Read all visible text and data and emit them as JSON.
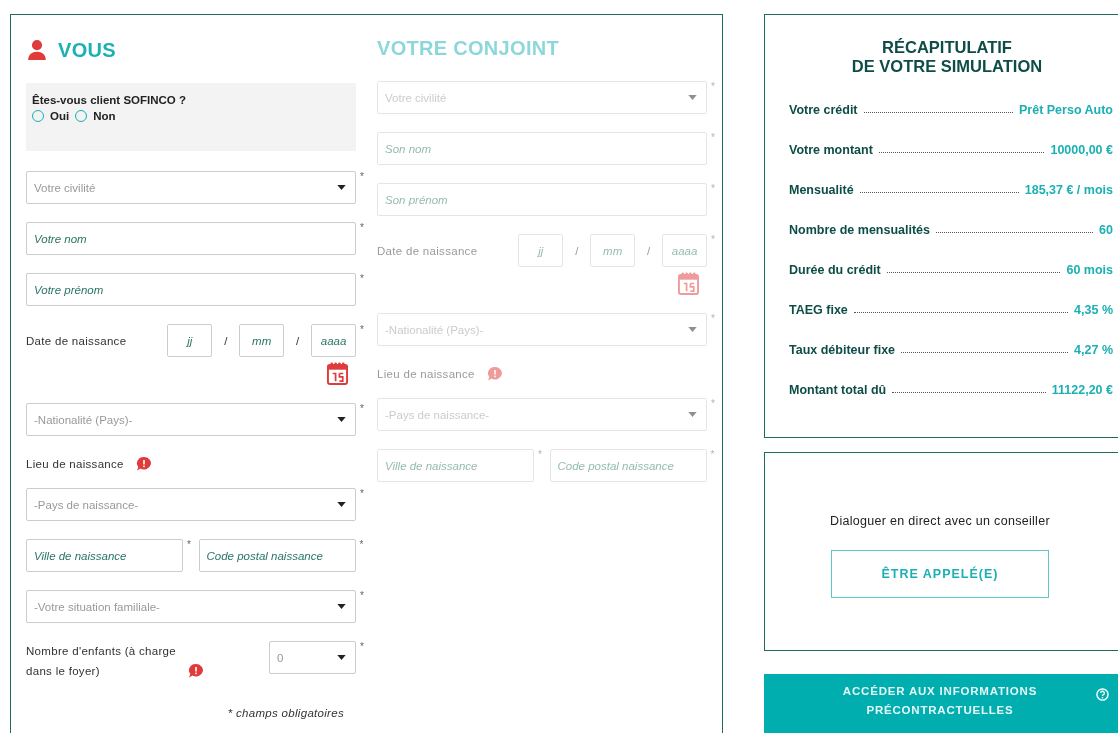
{
  "columns": [
    {
      "title": "VOUS",
      "person_icon": true,
      "disabled": false,
      "client_question": {
        "label": "Êtes-vous client SOFINCO ?",
        "options": [
          {
            "label": "Oui",
            "selected": false
          },
          {
            "label": "Non",
            "selected": false
          }
        ]
      },
      "fields": [
        {
          "kind": "select",
          "placeholder": "Votre civilité",
          "mark": "*"
        },
        {
          "kind": "text",
          "placeholder": "Votre nom",
          "mark": "*"
        },
        {
          "kind": "text",
          "placeholder": "Votre prénom",
          "mark": "*"
        },
        {
          "kind": "date",
          "label": "Date de naissance",
          "placeholders": [
            "jj",
            "mm",
            "aaaa"
          ],
          "separators": [
            "/",
            "/"
          ],
          "mark": "*"
        },
        {
          "kind": "select",
          "placeholder": "-Nationalité (Pays)-",
          "mark": "*"
        },
        {
          "kind": "label",
          "label": "Lieu de naissance",
          "help": true
        },
        {
          "kind": "select",
          "placeholder": "-Pays de naissance-",
          "mark": "*"
        },
        {
          "kind": "pair",
          "placeholders": [
            "Ville de naissance",
            "Code postal naissance"
          ],
          "marks": [
            "*",
            "*"
          ]
        },
        {
          "kind": "select",
          "placeholder": "-Votre situation familiale-",
          "mark": "*"
        },
        {
          "kind": "count",
          "label": "Nombre d'enfants (à charge dans le foyer)",
          "help": true,
          "placeholder": "0",
          "mark": "*"
        }
      ],
      "footnote": "* champs obligatoires"
    },
    {
      "title": "VOTRE CONJOINT",
      "person_icon": false,
      "disabled": true,
      "fields": [
        {
          "kind": "select",
          "placeholder": "Votre civilité",
          "mark": "*"
        },
        {
          "kind": "text",
          "placeholder": "Son nom",
          "mark": "*"
        },
        {
          "kind": "text",
          "placeholder": "Son prénom",
          "mark": "*"
        },
        {
          "kind": "date",
          "label": "Date de naissance",
          "placeholders": [
            "jj",
            "mm",
            "aaaa"
          ],
          "separators": [
            "/",
            "/"
          ],
          "mark": "*"
        },
        {
          "kind": "select",
          "placeholder": "-Nationalité (Pays)-",
          "mark": "*"
        },
        {
          "kind": "label",
          "label": "Lieu de naissance",
          "help": true
        },
        {
          "kind": "select",
          "placeholder": "-Pays de naissance-",
          "mark": "*"
        },
        {
          "kind": "pair",
          "placeholders": [
            "Ville de naissance",
            "Code postal naissance"
          ],
          "marks": [
            "*",
            "*"
          ]
        }
      ]
    }
  ],
  "summary": {
    "title": [
      "RÉCAPITULATIF",
      "DE VOTRE SIMULATION"
    ],
    "rows": [
      {
        "label": "Votre crédit",
        "value": "Prêt Perso Auto"
      },
      {
        "label": "Votre montant",
        "value": "10000,00 €"
      },
      {
        "label": "Mensualité",
        "value": "185,37 € / mois"
      },
      {
        "label": "Nombre de mensualités",
        "value": "60"
      },
      {
        "label": "Durée du crédit",
        "value": "60 mois"
      },
      {
        "label": "TAEG fixe",
        "value": "4,35 %"
      },
      {
        "label": "Taux débiteur fixe",
        "value": "4,27 %"
      },
      {
        "label": "Montant total dû",
        "value": "11122,20 €"
      }
    ]
  },
  "contact": {
    "text": "Dialoguer en direct avec un conseiller",
    "button": "ÊTRE APPELÉ(E)"
  },
  "info_button": {
    "label": "ACCÉDER AUX INFORMATIONS PRÉCONTRACTUELLES"
  }
}
